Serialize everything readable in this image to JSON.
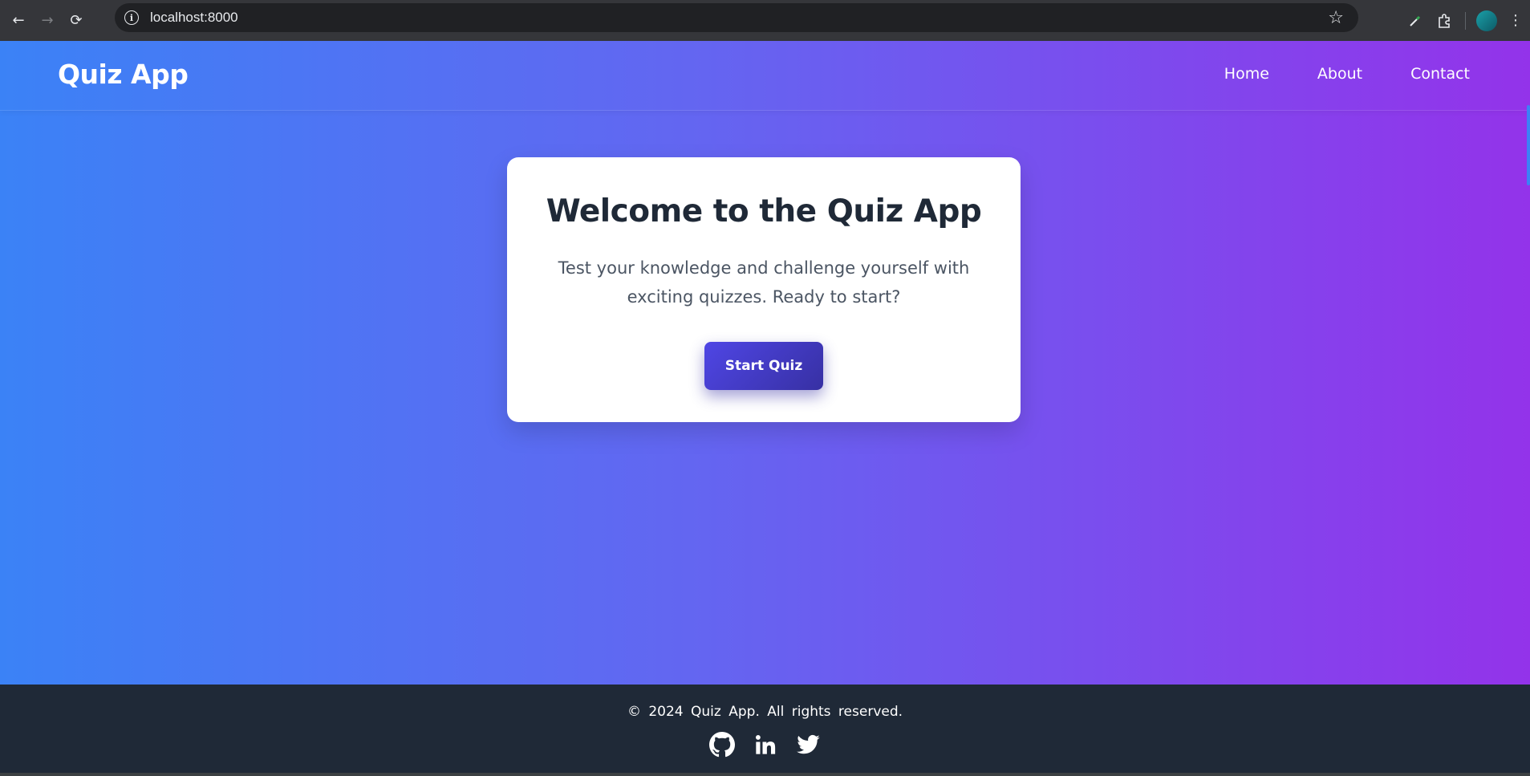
{
  "browser": {
    "url": "localhost:8000",
    "back_icon": "←",
    "forward_icon": "→",
    "reload_icon": "⟳",
    "info_icon": "i",
    "star_icon": "☆"
  },
  "header": {
    "brand": "Quiz App",
    "nav": [
      "Home",
      "About",
      "Contact"
    ]
  },
  "hero": {
    "title": "Welcome to the Quiz App",
    "description": "Test your knowledge and challenge yourself with exciting quizzes. Ready to start?",
    "button_label": "Start Quiz"
  },
  "footer": {
    "copyright": "© 2024  Quiz App.  All rights reserved.",
    "socials": [
      "github-icon",
      "linkedin-icon",
      "twitter-icon"
    ]
  },
  "colors": {
    "gradient_start": "#3b82f6",
    "gradient_mid": "#6366f1",
    "gradient_end": "#9333ea",
    "button": "#4f46e5",
    "footer_bg": "#1f2937"
  }
}
